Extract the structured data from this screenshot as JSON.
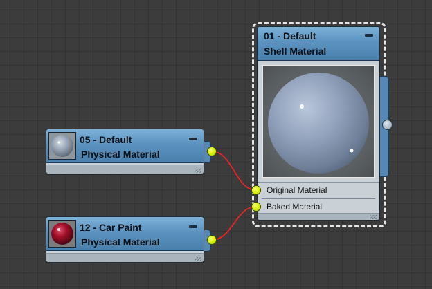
{
  "nodes": {
    "shell": {
      "line1": "01 - Default",
      "line2": "Shell Material",
      "slots": [
        "Original Material",
        "Baked Material"
      ]
    },
    "default05": {
      "line1": "05 - Default",
      "line2": "Physical Material"
    },
    "carpaint": {
      "line1": "12 - Car Paint",
      "line2": "Physical Material"
    }
  },
  "colors": {
    "background": "#3c3c3c",
    "node_header": "#5b92bf",
    "node_body": "#c9d0d6",
    "socket": "#d6f000",
    "wire": "#ff2020",
    "selection": "#e6e6e6"
  },
  "icons": {
    "minimize": "minimize-bar-icon",
    "resize_grip": "resize-grip-icon",
    "output_socket": "circle-socket-icon"
  }
}
